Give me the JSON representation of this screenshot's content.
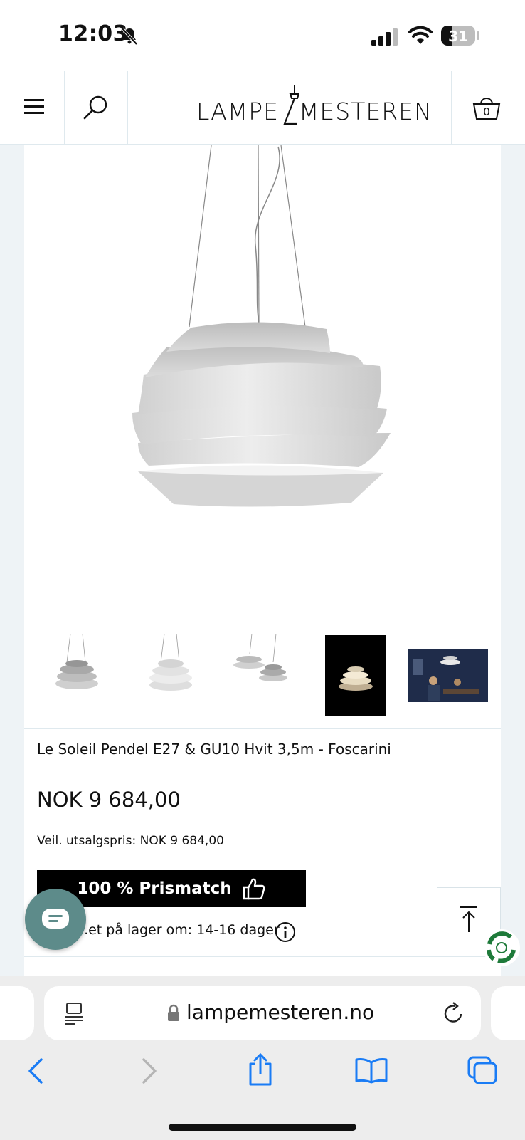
{
  "status_bar": {
    "time": "12:03",
    "battery": "31"
  },
  "header": {
    "brand_left": "LAMPE",
    "brand_right": "MESTEREN",
    "cart_count": "0"
  },
  "product": {
    "title": "Le Soleil Pendel E27 & GU10 Hvit 3,5m - Foscarini",
    "price": "NOK 9 684,00",
    "recommended_price": "Veil. utsalgspris: NOK 9 684,00",
    "prismatch_label": "100 % Prismatch",
    "stock_text": "...et på lager om: 14-16 dager"
  },
  "browser": {
    "url": "lampemesteren.no"
  },
  "colors": {
    "chat": "#5d8b8a",
    "accent_blue": "#1a7cf5",
    "recycle_green": "#1e7a3a"
  }
}
